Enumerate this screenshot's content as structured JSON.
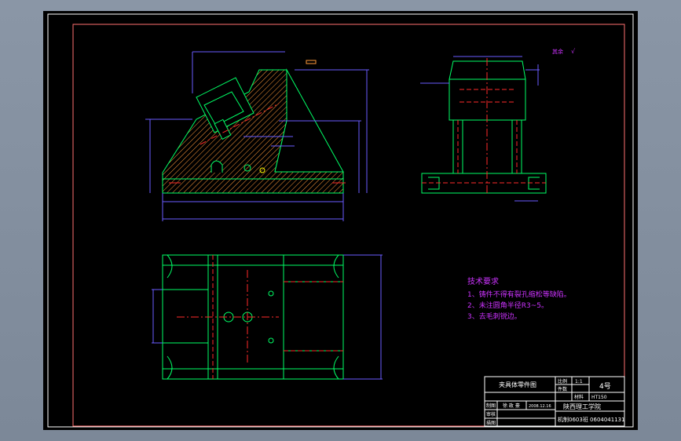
{
  "drawing": {
    "title_block": {
      "part_name": "夹具体零件图",
      "scale_label": "比例",
      "scale_value": "1:1",
      "sheet_no": "4号",
      "qty_label": "件数",
      "material_label": "材料",
      "material_value": "HT150",
      "designer_label": "制图",
      "designer_name": "徐 政 豪",
      "date": "2008.12.16",
      "checker_label": "审核",
      "review_label": "描图",
      "school_line": "陕西理工学院",
      "class_line": "机制0603班 0604041131"
    },
    "tech_requirements": {
      "heading": "技术要求",
      "items": [
        "1、铸件不得有裂孔缩松等缺陷。",
        "2、未注圆角半径R3~5。",
        "3、去毛刺锐边。"
      ]
    },
    "roughness_note": "其余"
  },
  "colors": {
    "background": "#000000",
    "frame": "#ff7070",
    "outline": "#00ff66",
    "dimension": "#6a5cff",
    "centerline": "#ff2a2a",
    "hatch": "#ff9a3a",
    "note": "#cc33ff",
    "annotation": "#e0e0e0"
  }
}
